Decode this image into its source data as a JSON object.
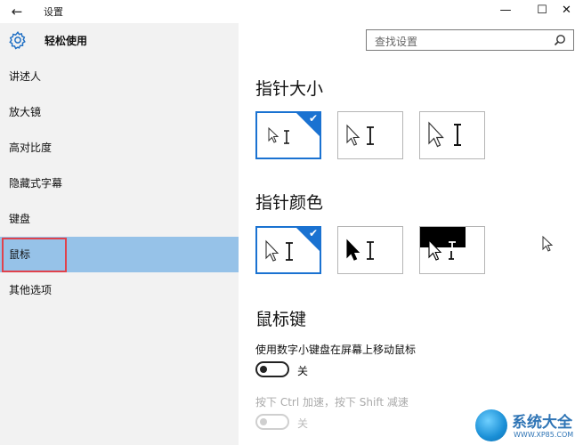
{
  "window": {
    "title": "设置",
    "controls": {
      "minimize": "—",
      "maximize": "☐",
      "close": "✕"
    }
  },
  "sidebar": {
    "title": "轻松使用",
    "items": [
      {
        "label": "讲述人"
      },
      {
        "label": "放大镜"
      },
      {
        "label": "高对比度"
      },
      {
        "label": "隐藏式字幕"
      },
      {
        "label": "键盘"
      },
      {
        "label": "鼠标",
        "active": true
      },
      {
        "label": "其他选项"
      }
    ]
  },
  "search": {
    "placeholder": "查找设置",
    "icon": "search-icon"
  },
  "main": {
    "pointer_size": {
      "title": "指针大小",
      "options": [
        {
          "name": "small",
          "selected": true
        },
        {
          "name": "medium",
          "selected": false
        },
        {
          "name": "large",
          "selected": false
        }
      ]
    },
    "pointer_color": {
      "title": "指针颜色",
      "options": [
        {
          "name": "white",
          "selected": true
        },
        {
          "name": "black",
          "selected": false
        },
        {
          "name": "inverted",
          "selected": false
        }
      ]
    },
    "mouse_keys": {
      "title": "鼠标键",
      "toggle_desc": "使用数字小键盘在屏幕上移动鼠标",
      "toggle_state": "关",
      "ctrl_shift_desc": "按下 Ctrl 加速，按下 Shift 减速",
      "ctrl_shift_state": "关"
    }
  },
  "watermark": {
    "title": "系统大全",
    "url": "WWW.XP85.COM"
  },
  "colors": {
    "accent": "#1a72d1",
    "active_nav": "#96c2e8",
    "highlight_box": "#e0424c",
    "sidebar_bg": "#f2f2f2"
  }
}
